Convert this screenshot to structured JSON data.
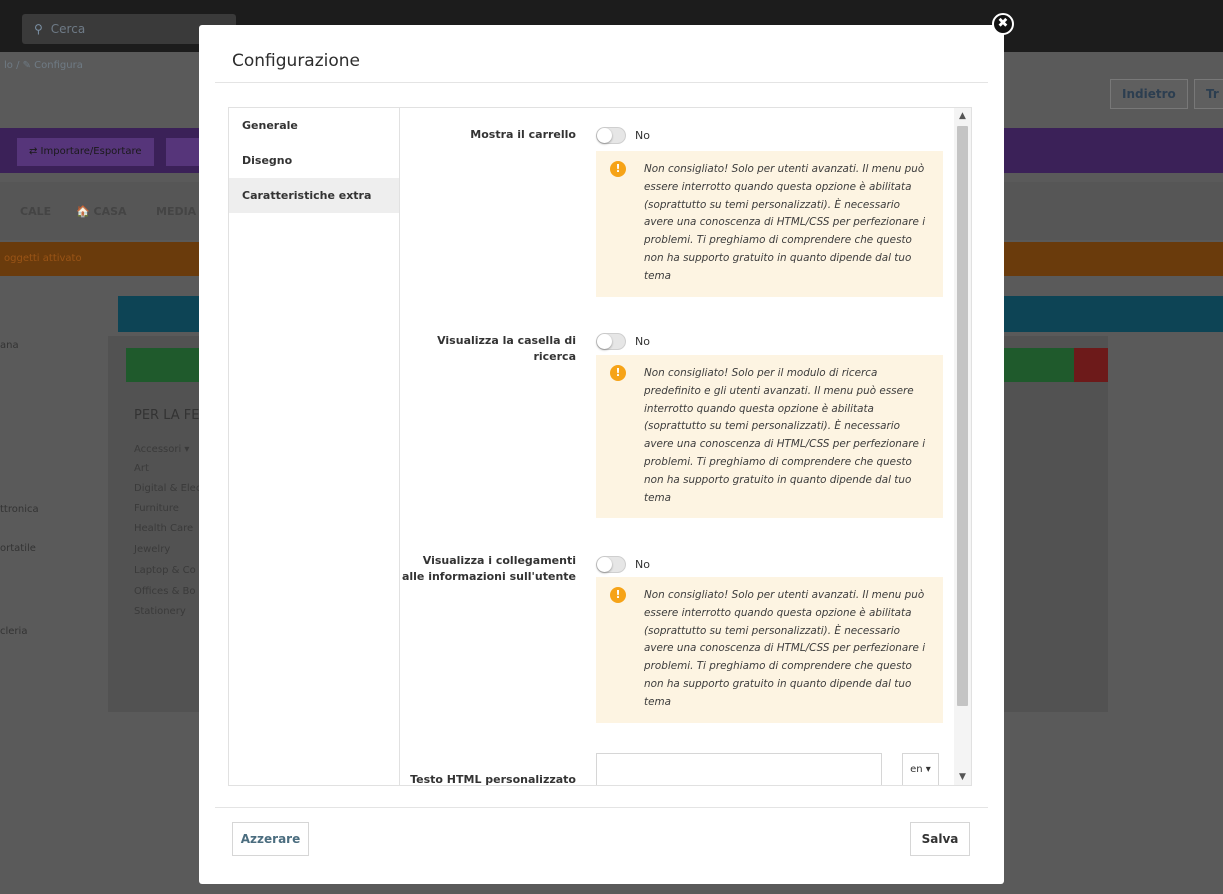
{
  "background": {
    "search_placeholder": "Cerca",
    "breadcrumb": "lo / ✎ Configura",
    "back_button": "Indietro",
    "right_button": "Tr",
    "import_export_button": "⇄ Importare/Esportare",
    "menu_items": [
      "CALE",
      "🏠 CASA",
      "MEDIA"
    ],
    "orange_notice": "oggetti attivato",
    "heading": "PER LA FE",
    "left_labels": [
      "ana",
      "ttronica",
      "ortatile",
      "cleria"
    ],
    "list_items": [
      "Accessori ▾",
      "Art",
      "Digital & Elec",
      "Furniture",
      "Health Care",
      "Jewelry",
      "Laptop & Co",
      "Offices & Bo",
      "Stationery"
    ]
  },
  "modal": {
    "title": "Configurazione",
    "close_symbol": "✖",
    "sidebar": {
      "items": [
        {
          "label": "Generale"
        },
        {
          "label": "Disegno"
        },
        {
          "label": "Caratteristiche extra",
          "active": true
        }
      ]
    },
    "settings": [
      {
        "label": "Mostra il carrello",
        "value": "No",
        "warning": "Non consigliato! Solo per utenti avanzati. Il menu può essere interrotto quando questa opzione è abilitata (soprattutto su temi personalizzati). È necessario avere una conoscenza di HTML/CSS per perfezionare i problemi. Ti preghiamo di comprendere che questo non ha supporto gratuito in quanto dipende dal tuo tema"
      },
      {
        "label": "Visualizza la casella di ricerca",
        "value": "No",
        "warning": "Non consigliato! Solo per il modulo di ricerca predefinito e gli utenti avanzati. Il menu può essere interrotto quando questa opzione è abilitata (soprattutto su temi personalizzati). È necessario avere una conoscenza di HTML/CSS per perfezionare i problemi. Ti preghiamo di comprendere che questo non ha supporto gratuito in quanto dipende dal tuo tema"
      },
      {
        "label": "Visualizza i collegamenti alle informazioni sull'utente",
        "value": "No",
        "warning": "Non consigliato! Solo per utenti avanzati. Il menu può essere interrotto quando questa opzione è abilitata (soprattutto su temi personalizzati). È necessario avere una conoscenza di HTML/CSS per perfezionare i problemi. Ti preghiamo di comprendere che questo non ha supporto gratuito in quanto dipende dal tuo tema"
      }
    ],
    "custom_html": {
      "label": "Testo HTML personalizzato",
      "value": "",
      "language": "en ▾"
    },
    "warning_icon": "!",
    "scroll_up": "▲",
    "scroll_down": "▼",
    "reset_button": "Azzerare",
    "save_button": "Salva"
  },
  "colors": {
    "warning_bg": "#fdf4e2",
    "warning_icon": "#f6a317",
    "active_tab_bg": "#eeeeee",
    "reset_text": "#4b6d7f"
  }
}
